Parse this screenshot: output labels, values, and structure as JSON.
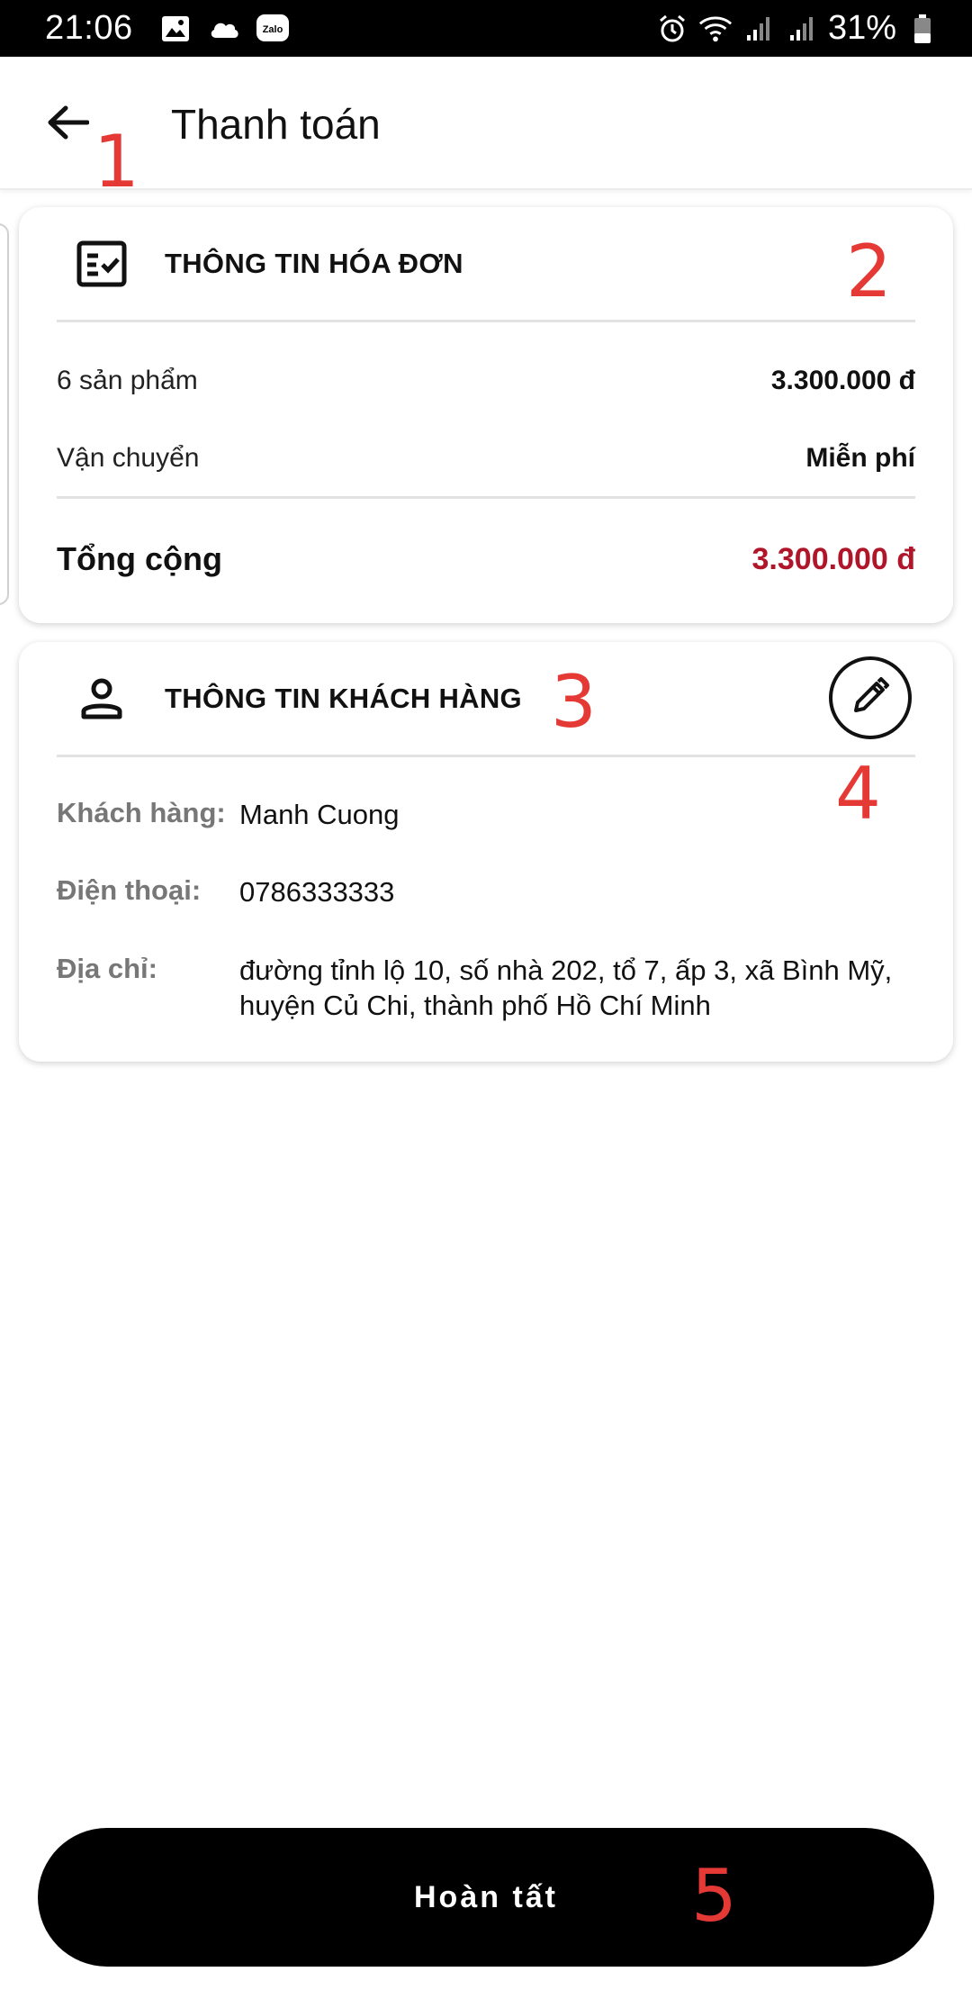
{
  "status_bar": {
    "time": "21:06",
    "left_icons": [
      "image-icon",
      "cloud-icon",
      "zalo-icon"
    ],
    "zalo_label": "Zalo",
    "battery_percent": "31%",
    "right_icons": [
      "alarm-icon",
      "wifi-icon",
      "signal-icon",
      "signal-icon",
      "battery-icon"
    ]
  },
  "app_bar": {
    "title": "Thanh toán",
    "back_icon": "arrow-left-icon"
  },
  "invoice": {
    "header_title": "THÔNG TIN HÓA ĐƠN",
    "header_icon": "receipt-check-icon",
    "products_label": "6 sản phẩm",
    "products_value": "3.300.000 đ",
    "shipping_label": "Vận chuyển",
    "shipping_value": "Miễn phí",
    "total_label": "Tổng cộng",
    "total_value": "3.300.000 đ",
    "total_color": "#b0162a"
  },
  "customer": {
    "header_title": "THÔNG TIN KHÁCH HÀNG",
    "header_icon": "person-icon",
    "edit_icon": "pencil-icon",
    "name_label": "Khách hàng:",
    "name_value": "Manh Cuong",
    "phone_label": "Điện thoại:",
    "phone_value": "0786333333",
    "address_label": "Địa chỉ:",
    "address_line1": "đường tỉnh lộ 10, số nhà 202, tổ 7, ấp 3, xã Bình Mỹ,",
    "address_line2": "huyện Củ Chi, thành phố Hồ Chí Minh"
  },
  "footer": {
    "finish_label": "Hoàn tất"
  },
  "annotations": {
    "a1": "1",
    "a2": "2",
    "a3": "3",
    "a4": "4",
    "a5": "5",
    "color": "#e53935"
  }
}
